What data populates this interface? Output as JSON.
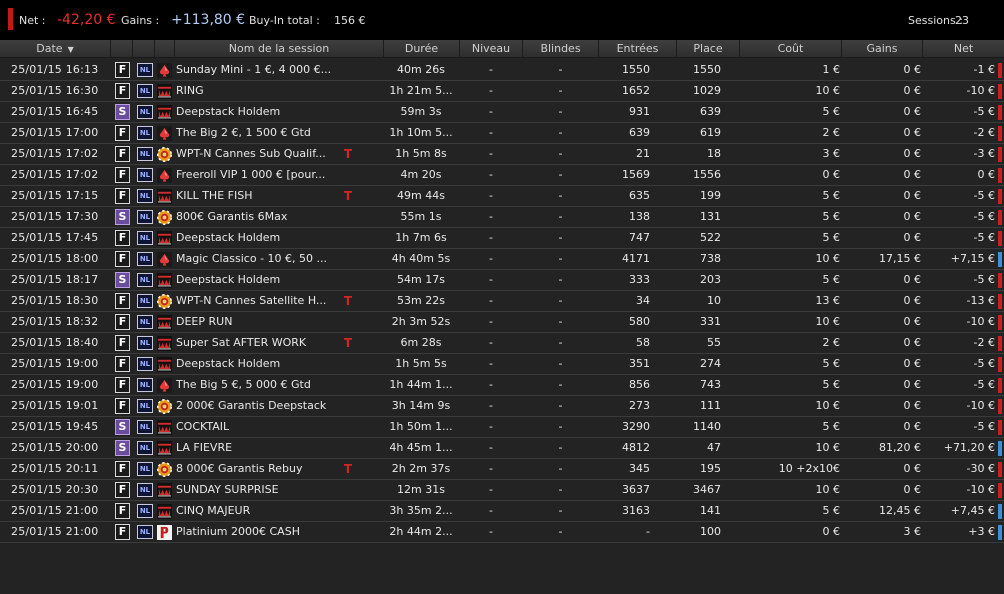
{
  "summary": {
    "net_label": "Net :",
    "net_value": "-42,20 €",
    "gains_label": "Gains :",
    "gains_value": "+113,80 €",
    "buyin_label": "Buy-In total :",
    "buyin_value": "156 €",
    "sessions_label": "Sessions :",
    "sessions_value": "23"
  },
  "columns": {
    "date": "Date",
    "name": "Nom de la session",
    "duration": "Durée",
    "level": "Niveau",
    "blinds": "Blindes",
    "entries": "Entrées",
    "place": "Place",
    "cost": "Coût",
    "gains": "Gains",
    "net": "Net"
  },
  "colors": {
    "negative": "#e83030",
    "positive_bar": "#3d8fd8",
    "negative_bar": "#cc2020",
    "type_s": "#6a4c9c"
  },
  "rows": [
    {
      "date": "25/01/15 16:13",
      "type": "F",
      "game": "NL",
      "room": "winamax-spade-icon",
      "name": "Sunday Mini - 1 €, 4 000 €...",
      "turbo": false,
      "duration": "40m 26s",
      "level": "-",
      "blinds": "-",
      "entries": "1550",
      "place": "1550",
      "cost": "1 €",
      "gains": "0 €",
      "net": "-1 €",
      "sign": "neg"
    },
    {
      "date": "25/01/15 16:30",
      "type": "F",
      "game": "NL",
      "room": "crown-icon",
      "name": "RING",
      "turbo": false,
      "duration": "1h 21m 5...",
      "level": "-",
      "blinds": "-",
      "entries": "1652",
      "place": "1029",
      "cost": "10 €",
      "gains": "0 €",
      "net": "-10 €",
      "sign": "neg"
    },
    {
      "date": "25/01/15 16:45",
      "type": "S",
      "game": "NL",
      "room": "crown-icon",
      "name": "Deepstack Holdem",
      "turbo": false,
      "duration": "59m 3s",
      "level": "-",
      "blinds": "-",
      "entries": "931",
      "place": "639",
      "cost": "5 €",
      "gains": "0 €",
      "net": "-5 €",
      "sign": "neg"
    },
    {
      "date": "25/01/15 17:00",
      "type": "F",
      "game": "NL",
      "room": "winamax-spade-icon",
      "name": "The Big 2 €, 1 500 € Gtd",
      "turbo": false,
      "duration": "1h 10m 5...",
      "level": "-",
      "blinds": "-",
      "entries": "639",
      "place": "619",
      "cost": "2 €",
      "gains": "0 €",
      "net": "-2 €",
      "sign": "neg"
    },
    {
      "date": "25/01/15 17:02",
      "type": "F",
      "game": "NL",
      "room": "chip-icon",
      "name": "WPT-N Cannes Sub Qualif...",
      "turbo": true,
      "duration": "1h 5m 8s",
      "level": "-",
      "blinds": "-",
      "entries": "21",
      "place": "18",
      "cost": "3 €",
      "gains": "0 €",
      "net": "-3 €",
      "sign": "neg"
    },
    {
      "date": "25/01/15 17:02",
      "type": "F",
      "game": "NL",
      "room": "winamax-spade-icon",
      "name": "Freeroll VIP 1 000 € [pour...",
      "turbo": false,
      "duration": "4m 20s",
      "level": "-",
      "blinds": "-",
      "entries": "1569",
      "place": "1556",
      "cost": "0 €",
      "gains": "0 €",
      "net": "0 €",
      "sign": "zero"
    },
    {
      "date": "25/01/15 17:15",
      "type": "F",
      "game": "NL",
      "room": "crown-icon",
      "name": "KILL THE FISH",
      "turbo": true,
      "duration": "49m 44s",
      "level": "-",
      "blinds": "-",
      "entries": "635",
      "place": "199",
      "cost": "5 €",
      "gains": "0 €",
      "net": "-5 €",
      "sign": "neg"
    },
    {
      "date": "25/01/15 17:30",
      "type": "S",
      "game": "NL",
      "room": "chip-icon",
      "name": "800€ Garantis 6Max",
      "turbo": false,
      "duration": "55m 1s",
      "level": "-",
      "blinds": "-",
      "entries": "138",
      "place": "131",
      "cost": "5 €",
      "gains": "0 €",
      "net": "-5 €",
      "sign": "neg"
    },
    {
      "date": "25/01/15 17:45",
      "type": "F",
      "game": "NL",
      "room": "crown-icon",
      "name": "Deepstack Holdem",
      "turbo": false,
      "duration": "1h 7m 6s",
      "level": "-",
      "blinds": "-",
      "entries": "747",
      "place": "522",
      "cost": "5 €",
      "gains": "0 €",
      "net": "-5 €",
      "sign": "neg"
    },
    {
      "date": "25/01/15 18:00",
      "type": "F",
      "game": "NL",
      "room": "winamax-spade-icon",
      "name": "Magic Classico - 10 €, 50 ...",
      "turbo": false,
      "duration": "4h 40m 5s",
      "level": "-",
      "blinds": "-",
      "entries": "4171",
      "place": "738",
      "cost": "10 €",
      "gains": "17,15 €",
      "net": "+7,15 €",
      "sign": "pos"
    },
    {
      "date": "25/01/15 18:17",
      "type": "S",
      "game": "NL",
      "room": "crown-icon",
      "name": "Deepstack Holdem",
      "turbo": false,
      "duration": "54m 17s",
      "level": "-",
      "blinds": "-",
      "entries": "333",
      "place": "203",
      "cost": "5 €",
      "gains": "0 €",
      "net": "-5 €",
      "sign": "neg"
    },
    {
      "date": "25/01/15 18:30",
      "type": "F",
      "game": "NL",
      "room": "chip-icon",
      "name": "WPT-N Cannes Satellite H...",
      "turbo": true,
      "duration": "53m 22s",
      "level": "-",
      "blinds": "-",
      "entries": "34",
      "place": "10",
      "cost": "13 €",
      "gains": "0 €",
      "net": "-13 €",
      "sign": "neg"
    },
    {
      "date": "25/01/15 18:32",
      "type": "F",
      "game": "NL",
      "room": "crown-icon",
      "name": "DEEP RUN",
      "turbo": false,
      "duration": "2h 3m 52s",
      "level": "-",
      "blinds": "-",
      "entries": "580",
      "place": "331",
      "cost": "10 €",
      "gains": "0 €",
      "net": "-10 €",
      "sign": "neg"
    },
    {
      "date": "25/01/15 18:40",
      "type": "F",
      "game": "NL",
      "room": "crown-icon",
      "name": "Super Sat AFTER WORK",
      "turbo": true,
      "duration": "6m 28s",
      "level": "-",
      "blinds": "-",
      "entries": "58",
      "place": "55",
      "cost": "2 €",
      "gains": "0 €",
      "net": "-2 €",
      "sign": "neg"
    },
    {
      "date": "25/01/15 19:00",
      "type": "F",
      "game": "NL",
      "room": "crown-icon",
      "name": "Deepstack Holdem",
      "turbo": false,
      "duration": "1h 5m 5s",
      "level": "-",
      "blinds": "-",
      "entries": "351",
      "place": "274",
      "cost": "5 €",
      "gains": "0 €",
      "net": "-5 €",
      "sign": "neg"
    },
    {
      "date": "25/01/15 19:00",
      "type": "F",
      "game": "NL",
      "room": "winamax-spade-icon",
      "name": "The Big 5 €, 5 000 € Gtd",
      "turbo": false,
      "duration": "1h 44m 1...",
      "level": "-",
      "blinds": "-",
      "entries": "856",
      "place": "743",
      "cost": "5 €",
      "gains": "0 €",
      "net": "-5 €",
      "sign": "neg"
    },
    {
      "date": "25/01/15 19:01",
      "type": "F",
      "game": "NL",
      "room": "chip-icon",
      "name": "2 000€ Garantis Deepstack",
      "turbo": false,
      "duration": "3h 14m 9s",
      "level": "-",
      "blinds": "-",
      "entries": "273",
      "place": "111",
      "cost": "10 €",
      "gains": "0 €",
      "net": "-10 €",
      "sign": "neg"
    },
    {
      "date": "25/01/15 19:45",
      "type": "S",
      "game": "NL",
      "room": "crown-icon",
      "name": "COCKTAIL",
      "turbo": false,
      "duration": "1h 50m 1...",
      "level": "-",
      "blinds": "-",
      "entries": "3290",
      "place": "1140",
      "cost": "5 €",
      "gains": "0 €",
      "net": "-5 €",
      "sign": "neg"
    },
    {
      "date": "25/01/15 20:00",
      "type": "S",
      "game": "NL",
      "room": "crown-icon",
      "name": "LA FIEVRE",
      "turbo": false,
      "duration": "4h 45m 1...",
      "level": "-",
      "blinds": "-",
      "entries": "4812",
      "place": "47",
      "cost": "10 €",
      "gains": "81,20 €",
      "net": "+71,20 €",
      "sign": "pos"
    },
    {
      "date": "25/01/15 20:11",
      "type": "F",
      "game": "NL",
      "room": "chip-icon",
      "name": "8 000€ Garantis Rebuy",
      "turbo": true,
      "duration": "2h 2m 37s",
      "level": "-",
      "blinds": "-",
      "entries": "345",
      "place": "195",
      "cost": "10  +2x10€",
      "gains": "0 €",
      "net": "-30 €",
      "sign": "neg"
    },
    {
      "date": "25/01/15 20:30",
      "type": "F",
      "game": "NL",
      "room": "crown-icon",
      "name": "SUNDAY SURPRISE",
      "turbo": false,
      "duration": "12m 31s",
      "level": "-",
      "blinds": "-",
      "entries": "3637",
      "place": "3467",
      "cost": "10 €",
      "gains": "0 €",
      "net": "-10 €",
      "sign": "neg"
    },
    {
      "date": "25/01/15 21:00",
      "type": "F",
      "game": "NL",
      "room": "crown-icon",
      "name": "CINQ MAJEUR",
      "turbo": false,
      "duration": "3h 35m 2...",
      "level": "-",
      "blinds": "-",
      "entries": "3163",
      "place": "141",
      "cost": "5 €",
      "gains": "12,45 €",
      "net": "+7,45 €",
      "sign": "pos"
    },
    {
      "date": "25/01/15 21:00",
      "type": "F",
      "game": "NL",
      "room": "poker-logo-icon",
      "name": "Platinium 2000€ CASH",
      "turbo": false,
      "duration": "2h 44m 2...",
      "level": "-",
      "blinds": "-",
      "entries": "-",
      "place": "100",
      "cost": "0 €",
      "gains": "3 €",
      "net": "+3 €",
      "sign": "pos"
    }
  ]
}
